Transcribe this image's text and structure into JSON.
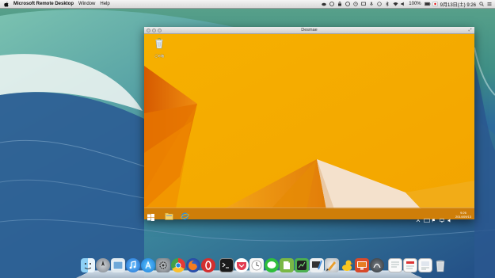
{
  "menubar": {
    "app_name": "Microsoft Remote Desktop",
    "menus": [
      "Window",
      "Help"
    ],
    "status_right": {
      "battery": "100%",
      "clock": "9月13日(土) 9:26"
    }
  },
  "rd_window": {
    "title": "Desmae"
  },
  "windows": {
    "recycle_bin_label": "ごみ箱",
    "clock_time": "9:26",
    "clock_date": "2014/09/13"
  },
  "colors": {
    "win_orange": "#f0a300",
    "win_dark_orange": "#e06d00",
    "taskbar": "#c9780a"
  },
  "dock": {
    "apps": [
      "finder-icon",
      "launchpad-icon",
      "preview-icon",
      "itunes-icon",
      "app-store-icon",
      "system-preferences-icon",
      "chrome-icon",
      "firefox-icon",
      "opera-icon",
      "terminal-icon",
      "pocket-icon",
      "reminders-icon",
      "line-icon",
      "evernote-icon",
      "istat-icon",
      "xcode-icon",
      "pixelmator-icon",
      "cyberduck-icon",
      "remote-desktop-icon",
      "keynote-icon",
      "document-icon",
      "textedit-icon",
      "pages-icon",
      "trash-icon"
    ]
  }
}
